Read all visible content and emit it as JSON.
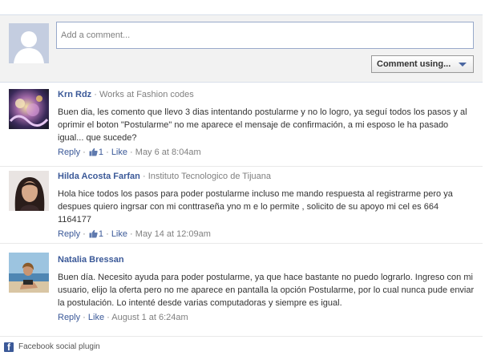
{
  "composer": {
    "placeholder": "Add a comment...",
    "comment_using_label": "Comment using..."
  },
  "comments": [
    {
      "name": "Krn Rdz",
      "separator": " · ",
      "affiliation": "Works at Fashion codes",
      "text": "Buen dia, les comento que llevo 3 dias intentando postularme y no lo logro, ya seguí todos los pasos y al oprimir el boton \"Postularme\" no me aparece el mensaje de confirmación, a mi esposo le ha pasado igual... que sucede?",
      "reply": "Reply",
      "like_count": "1",
      "like": "Like",
      "timestamp": "May 6 at 8:04am"
    },
    {
      "name": "Hilda Acosta Farfan",
      "separator": " · ",
      "affiliation": "Instituto Tecnologico de Tijuana",
      "text": "Hola hice todos los pasos para poder postularme incluso me mando respuesta al registrarme pero ya despues quiero ingrsar con mi conttraseña yno m e lo permite , solicito de su apoyo mi cel es 664 1164177",
      "reply": "Reply",
      "like_count": "1",
      "like": "Like",
      "timestamp": "May 14 at 12:09am"
    },
    {
      "name": "Natalia Bressan",
      "text": "Buen día. Necesito ayuda para poder postularme, ya que hace bastante no puedo lograrlo. Ingreso con mi usuario, elijo la oferta pero no me aparece en pantalla la opción Postularme, por lo cual nunca pude enviar la postulación. Lo intenté desde varias computadoras y siempre es igual.",
      "reply": "Reply",
      "like": "Like",
      "timestamp": "August 1 at 6:24am"
    }
  ],
  "dot": " · ",
  "footer": {
    "label": "Facebook social plugin",
    "icon_letter": "f"
  },
  "colors": {
    "link": "#3b5998",
    "muted": "#808080",
    "composer_bg": "#f2f2f2"
  },
  "icons": [
    "default-avatar-icon",
    "caret-down-icon",
    "thumbs-up-icon",
    "facebook-icon"
  ]
}
